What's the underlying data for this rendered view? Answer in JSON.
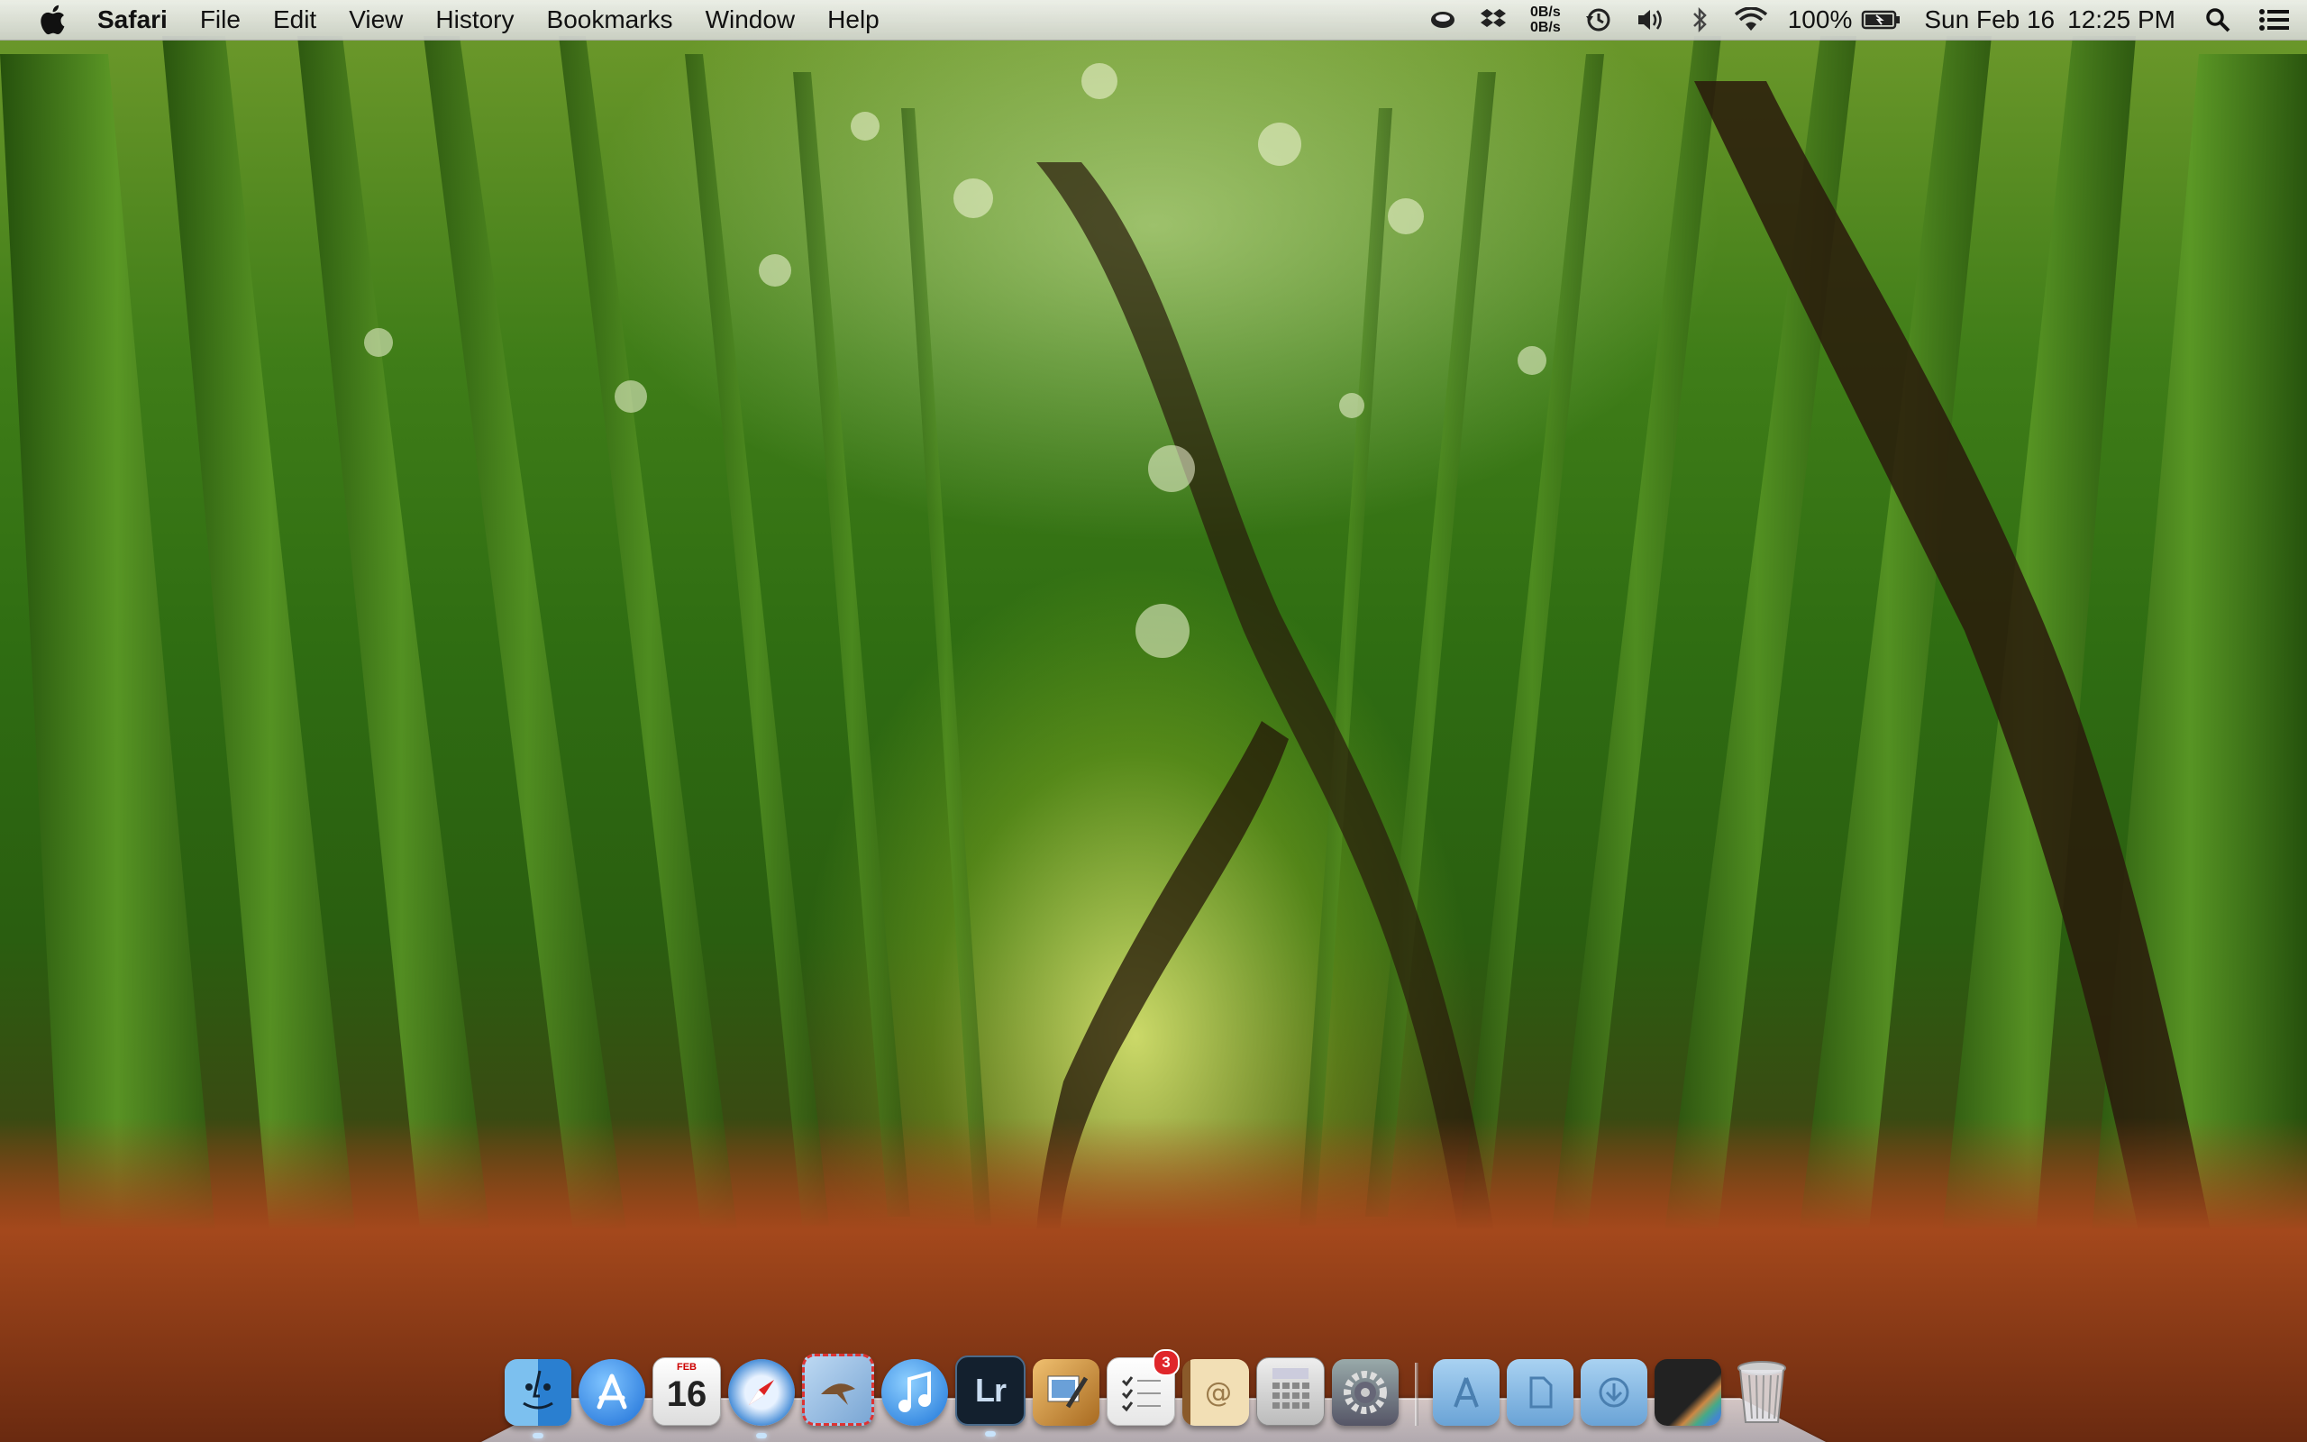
{
  "menubar": {
    "apple_icon": "apple-icon",
    "app_name": "Safari",
    "menus": [
      "File",
      "Edit",
      "View",
      "History",
      "Bookmarks",
      "Window",
      "Help"
    ],
    "status": {
      "net_up": "0B/s",
      "net_down": "0B/s",
      "battery": "100%",
      "date": "Sun Feb 16",
      "time": "12:25 PM"
    }
  },
  "dock": {
    "items": [
      {
        "name": "finder"
      },
      {
        "name": "app-store"
      },
      {
        "name": "calendar",
        "month": "FEB",
        "day": "16"
      },
      {
        "name": "safari"
      },
      {
        "name": "mail"
      },
      {
        "name": "itunes"
      },
      {
        "name": "lightroom",
        "label": "Lr"
      },
      {
        "name": "preview"
      },
      {
        "name": "reminders",
        "badge": "3"
      },
      {
        "name": "contacts"
      },
      {
        "name": "calculator"
      },
      {
        "name": "system-preferences"
      },
      {
        "name": "applications-folder"
      },
      {
        "name": "documents-folder"
      },
      {
        "name": "downloads-folder"
      },
      {
        "name": "stack"
      },
      {
        "name": "trash"
      }
    ]
  },
  "colors": {
    "menubar": "#e6e6e6",
    "badge": "#e0262a",
    "wallpaper_green": "#3f7d18",
    "wallpaper_ground": "#a0481c"
  }
}
